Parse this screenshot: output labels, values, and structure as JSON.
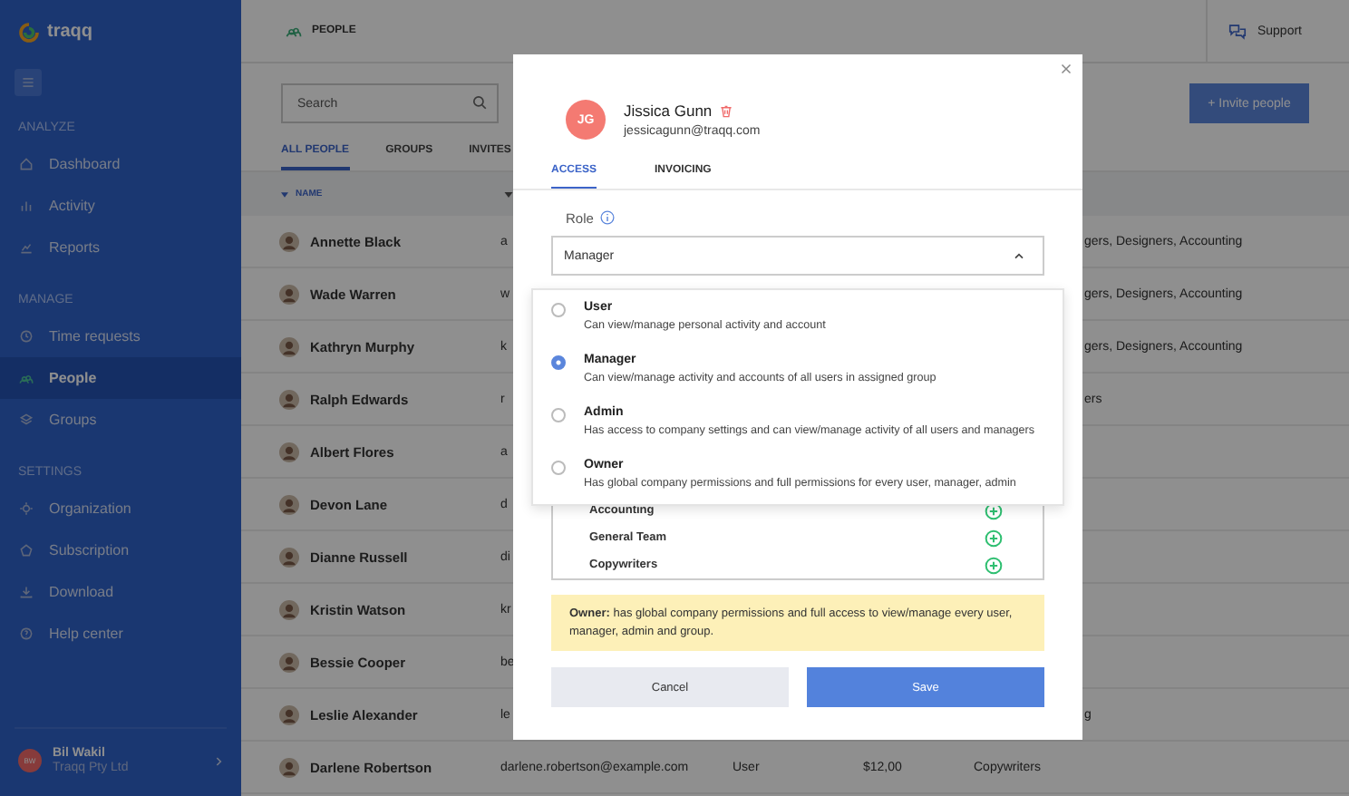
{
  "sidebar": {
    "brand": "traqq",
    "sections": [
      {
        "heading": "ANALYZE",
        "items": [
          {
            "label": "Dashboard",
            "selected": false
          },
          {
            "label": "Activity",
            "selected": false
          },
          {
            "label": "Reports",
            "selected": false
          }
        ]
      },
      {
        "heading": "MANAGE",
        "items": [
          {
            "label": "Time requests",
            "selected": false
          },
          {
            "label": "People",
            "selected": true
          },
          {
            "label": "Groups",
            "selected": false
          }
        ]
      },
      {
        "heading": "SETTINGS",
        "items": [
          {
            "label": "Organization",
            "selected": false
          },
          {
            "label": "Subscription",
            "selected": false
          },
          {
            "label": "Download",
            "selected": false
          },
          {
            "label": "Help center",
            "selected": false
          }
        ]
      }
    ],
    "user": {
      "initials": "BW",
      "name": "Bil Wakil",
      "company": "Traqq Pty Ltd"
    }
  },
  "header": {
    "title": "PEOPLE",
    "support": "Support"
  },
  "search": {
    "placeholder": "Search"
  },
  "invite_button": "+ Invite people",
  "tabs": [
    {
      "label": "ALL PEOPLE",
      "selected": true
    },
    {
      "label": "GROUPS",
      "selected": false
    },
    {
      "label": "INVITES",
      "selected": false
    }
  ],
  "table": {
    "sort_column": "NAME",
    "rows": [
      {
        "kind": "cut",
        "name": "Annette Black",
        "email": "a",
        "groups": "gers, Designers, Accounting"
      },
      {
        "kind": "cut",
        "name": "Wade Warren",
        "email": "w",
        "groups": "gers, Designers, Accounting"
      },
      {
        "kind": "cut",
        "name": "Kathryn Murphy",
        "email": "k",
        "groups": "gers, Designers, Accounting"
      },
      {
        "kind": "cut",
        "name": "Ralph Edwards",
        "email": "r",
        "groups": "ers"
      },
      {
        "kind": "cut",
        "name": "Albert Flores",
        "email": "a"
      },
      {
        "kind": "cut",
        "name": "Devon Lane",
        "email": "d"
      },
      {
        "kind": "cut",
        "name": "Dianne Russell",
        "email": "di"
      },
      {
        "kind": "cut",
        "name": "Kristin Watson",
        "email": "kr"
      },
      {
        "kind": "cut",
        "name": "Bessie Cooper",
        "email": "be"
      },
      {
        "kind": "cut",
        "name": "Leslie Alexander",
        "email": "le",
        "groups": "g"
      },
      {
        "kind": "full",
        "name": "Darlene Robertson",
        "email": "darlene.robertson@example.com",
        "role": "User",
        "rate": "$12,00",
        "groups": "Copywriters"
      }
    ]
  },
  "modal": {
    "initials": "JG",
    "name": "Jissica Gunn",
    "email": "jessicagunn@traqq.com",
    "tabs": [
      {
        "label": "ACCESS",
        "selected": true
      },
      {
        "label": "INVOICING",
        "selected": false
      }
    ],
    "role_label": "Role",
    "role_value": "Manager",
    "expanded": true,
    "role_options": [
      {
        "title": "User",
        "description": "Can view/manage personal activity and account",
        "selected": false
      },
      {
        "title": "Manager",
        "description": "Can view/manage activity and accounts of all users in assigned group",
        "selected": true
      },
      {
        "title": "Admin",
        "description": "Has access to company settings and can view/manage activity of all users and managers",
        "selected": false
      },
      {
        "title": "Owner",
        "description": "Has global company permissions and full permissions for every user, manager, admin",
        "selected": false
      }
    ],
    "groups": [
      "Accounting",
      "General Team",
      "Copywriters"
    ],
    "notice": "**Owner:** has global company permissions and full access to view/manage every user, manager, admin and group.",
    "cancel": "Cancel",
    "save": "Save"
  }
}
